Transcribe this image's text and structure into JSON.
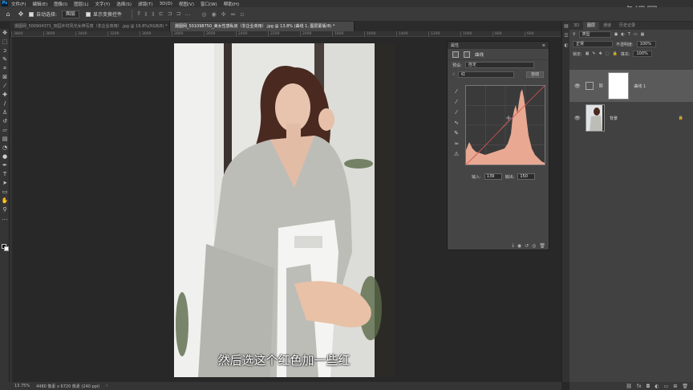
{
  "menubar": {
    "logo": "Ps",
    "items": [
      "文件(F)",
      "编辑(E)",
      "图像(I)",
      "图层(L)",
      "文字(Y)",
      "选择(S)",
      "滤镜(T)",
      "3D(D)",
      "视图(V)",
      "窗口(W)",
      "帮助(H)"
    ]
  },
  "options": {
    "auto_select_label": "自动选择:",
    "auto_select_value": "图层",
    "show_transform_label": "显示变换控件"
  },
  "tabs": [
    {
      "label": "摄图网_500904371_田园乡村风光女神写真（非企业商用）.jpg @ 16.8%(RGB/8) *",
      "active": false
    },
    {
      "label": "摄图网_501098750_美女性感私房（非企业商用）.jpg @ 13.8% (曲线 1, 图层蒙版/8) *",
      "active": true
    }
  ],
  "ruler": [
    "3800",
    "3600",
    "3400",
    "3200",
    "3000",
    "2800",
    "2600",
    "2400",
    "2200",
    "2000",
    "1800",
    "1600",
    "1400",
    "1200",
    "1000",
    "800",
    "600"
  ],
  "subtitle": "然后选这个红色加一些红",
  "status": {
    "zoom": "13.75%",
    "doc_size": "4480 像素 x 6720 像素 (240 ppi)"
  },
  "properties": {
    "header": "属性",
    "title": "曲线",
    "preset_label": "预设:",
    "preset_value": "自定",
    "channel_value": "红",
    "auto_button": "自动",
    "input_label": "输入:",
    "input_value": "139",
    "output_label": "输出:",
    "output_value": "150"
  },
  "layers_panel": {
    "tabs": [
      "3D",
      "图层",
      "通道",
      "历史记录"
    ],
    "kind_label": "类型",
    "blend_mode": "正常",
    "opacity_label": "不透明度:",
    "opacity_value": "100%",
    "lock_label": "锁定:",
    "fill_label": "填充:",
    "fill_value": "100%",
    "layers": [
      {
        "name": "曲线 1",
        "type": "adjustment",
        "selected": true
      },
      {
        "name": "背景",
        "type": "image",
        "selected": false
      }
    ]
  },
  "watermark": "虎课网",
  "colors": {
    "subtitle": "#ffffff",
    "histogram": "#e8a892",
    "curve_line": "#d9534f",
    "panel_bg": "#454545"
  }
}
